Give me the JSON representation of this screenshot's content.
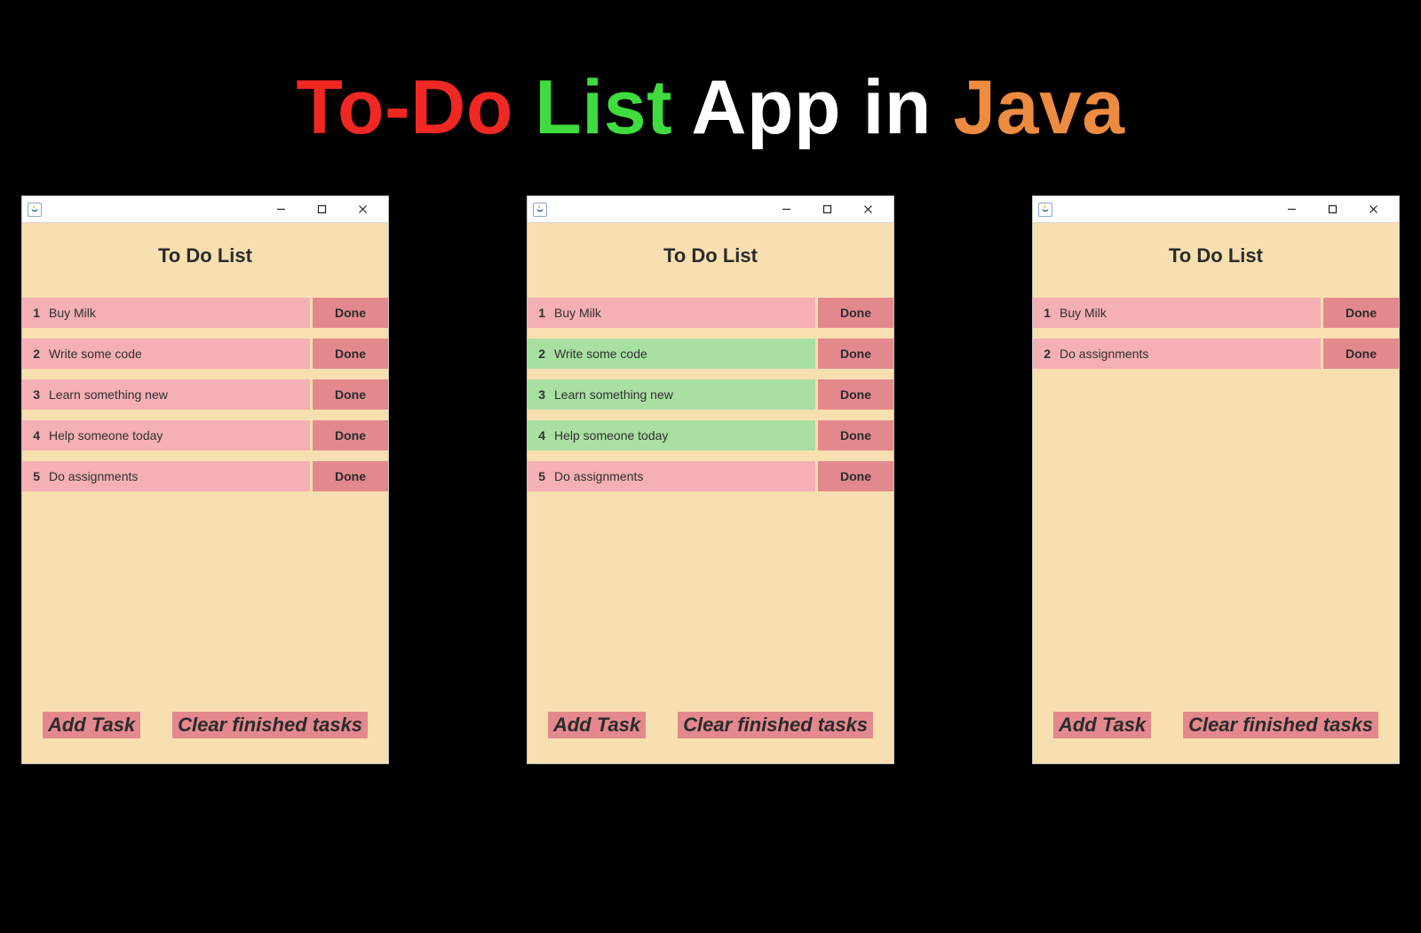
{
  "heading": {
    "part1": "To-Do",
    "part2": "List",
    "part3": "App in",
    "part4": "Java"
  },
  "titlebar": {
    "minimize": "–",
    "maximize": "□",
    "close": "×"
  },
  "window_title": "To Do List",
  "done_label": "Done",
  "footer": {
    "add": "Add Task",
    "clear": "Clear finished tasks"
  },
  "windows": [
    {
      "tasks": [
        {
          "num": "1",
          "text": "Buy Milk",
          "state": "pink"
        },
        {
          "num": "2",
          "text": "Write some code",
          "state": "pink"
        },
        {
          "num": "3",
          "text": "Learn something new",
          "state": "pink"
        },
        {
          "num": "4",
          "text": "Help someone today",
          "state": "pink"
        },
        {
          "num": "5",
          "text": "Do assignments",
          "state": "pink"
        }
      ]
    },
    {
      "tasks": [
        {
          "num": "1",
          "text": "Buy Milk",
          "state": "pink"
        },
        {
          "num": "2",
          "text": "Write some code",
          "state": "green"
        },
        {
          "num": "3",
          "text": "Learn something new",
          "state": "green"
        },
        {
          "num": "4",
          "text": "Help someone today",
          "state": "green"
        },
        {
          "num": "5",
          "text": "Do assignments",
          "state": "pink"
        }
      ]
    },
    {
      "tasks": [
        {
          "num": "1",
          "text": "Buy Milk",
          "state": "pink"
        },
        {
          "num": "2",
          "text": "Do assignments",
          "state": "pink"
        }
      ]
    }
  ]
}
